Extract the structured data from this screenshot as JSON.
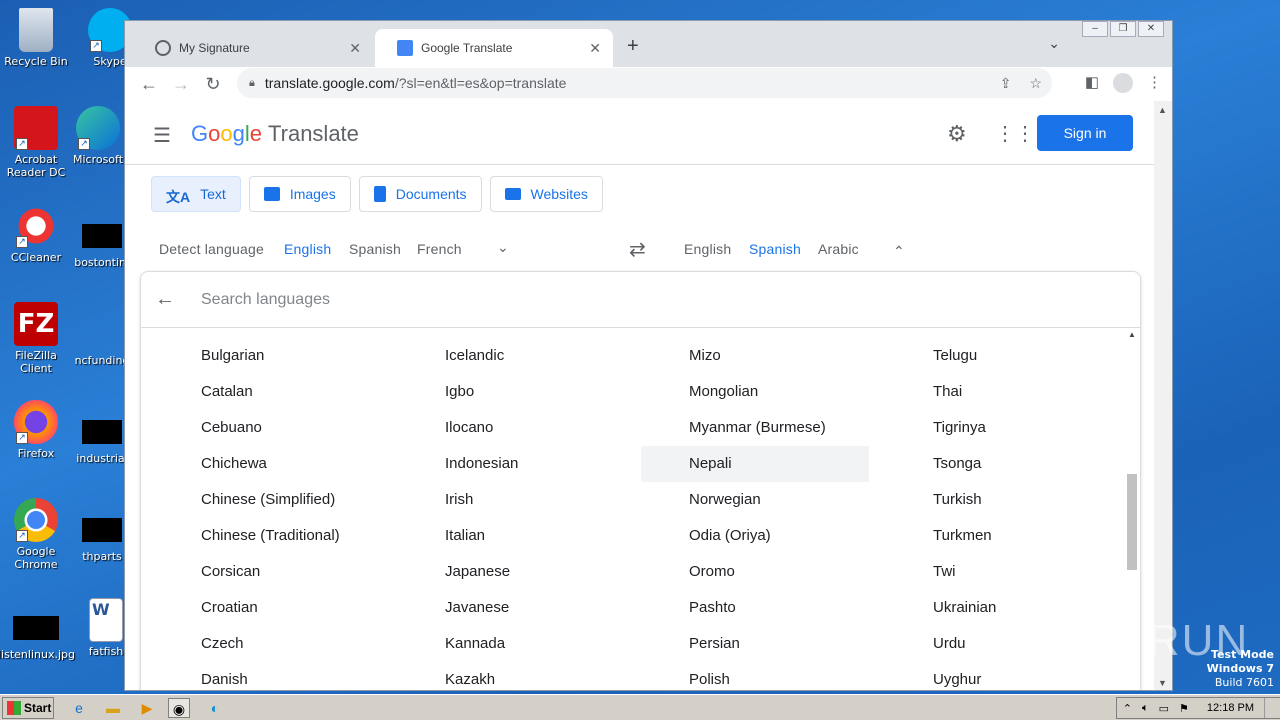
{
  "desktop": {
    "icons": [
      {
        "label": "Recycle Bin"
      },
      {
        "label": "Skype"
      },
      {
        "label": "Acrobat Reader DC"
      },
      {
        "label": "Microsoft"
      },
      {
        "label": "CCleaner"
      },
      {
        "label": "bostontim"
      },
      {
        "label": "FileZilla Client"
      },
      {
        "label": "ncfunding"
      },
      {
        "label": "Firefox"
      },
      {
        "label": "industrial"
      },
      {
        "label": "Google Chrome"
      },
      {
        "label": "thparts"
      },
      {
        "label": "listenlinux.jpg"
      },
      {
        "label": "fatfish"
      }
    ],
    "watermark": "ANY RUN",
    "test_mode": {
      "line1": "Test Mode",
      "line2": "Windows 7",
      "line3": "Build 7601"
    }
  },
  "browser": {
    "tabs": [
      {
        "title": "My Signature",
        "active": false
      },
      {
        "title": "Google Translate",
        "active": true
      }
    ],
    "url_host": "translate.google.com",
    "url_path": "/?sl=en&tl=es&op=translate"
  },
  "page": {
    "logo_google": "Google",
    "logo_translate": "Translate",
    "sign_in": "Sign in",
    "modes": [
      {
        "label": "Text"
      },
      {
        "label": "Images"
      },
      {
        "label": "Documents"
      },
      {
        "label": "Websites"
      }
    ],
    "source_langs": [
      "Detect language",
      "English",
      "Spanish",
      "French"
    ],
    "source_selected": "English",
    "target_langs": [
      "English",
      "Spanish",
      "Arabic"
    ],
    "target_selected": "Spanish",
    "search_placeholder": "Search languages",
    "language_columns": [
      [
        "Bulgarian",
        "Catalan",
        "Cebuano",
        "Chichewa",
        "Chinese (Simplified)",
        "Chinese (Traditional)",
        "Corsican",
        "Croatian",
        "Czech",
        "Danish"
      ],
      [
        "Icelandic",
        "Igbo",
        "Ilocano",
        "Indonesian",
        "Irish",
        "Italian",
        "Japanese",
        "Javanese",
        "Kannada",
        "Kazakh"
      ],
      [
        "Mizo",
        "Mongolian",
        "Myanmar (Burmese)",
        "Nepali",
        "Norwegian",
        "Odia (Oriya)",
        "Oromo",
        "Pashto",
        "Persian",
        "Polish"
      ],
      [
        "Telugu",
        "Thai",
        "Tigrinya",
        "Tsonga",
        "Turkish",
        "Turkmen",
        "Twi",
        "Ukrainian",
        "Urdu",
        "Uyghur"
      ]
    ],
    "highlighted_language": "Nepali"
  },
  "taskbar": {
    "start_label": "Start",
    "clock": "12:18 PM"
  }
}
